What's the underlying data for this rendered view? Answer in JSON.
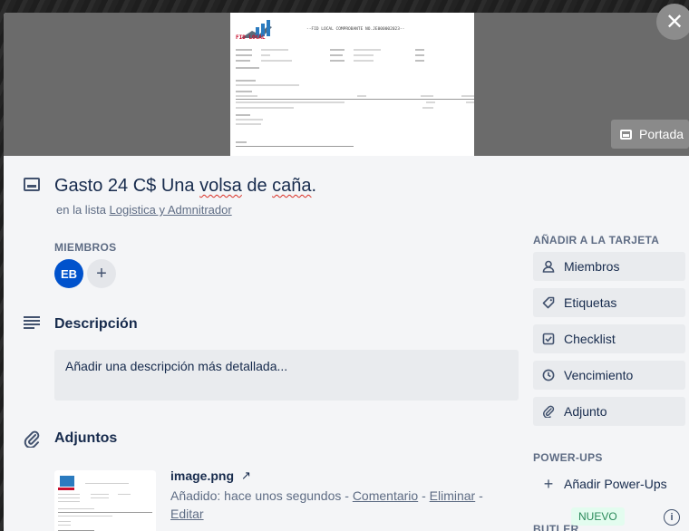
{
  "cover": {
    "doc_header": "--FID LOCAL COMPROBANTE NO.JE000002023--",
    "logo_text": "FID LOCAL",
    "button_label": "Portada"
  },
  "close_icon": "close-icon",
  "card": {
    "title_prefix": "Gasto 24 C$ Una ",
    "title_misspelled": "volsa",
    "title_middle": " de ",
    "title_misspelled2": "caña",
    "title_suffix": ".",
    "list_prefix": "en la lista ",
    "list_name": "Logistica y Admnitrador"
  },
  "members": {
    "label": "MIEMBROS",
    "avatar_initials": "EB",
    "add_symbol": "+"
  },
  "description": {
    "heading": "Descripción",
    "placeholder": "Añadir una descripción más detallada..."
  },
  "attachments": {
    "heading": "Adjuntos",
    "file_name": "image.png",
    "open_symbol": "↗",
    "added_text": "Añadido: hace unos segundos - ",
    "comment_link": "Comentario",
    "sep1": " - ",
    "delete_link": "Eliminar",
    "sep2": " - ",
    "edit_link": "Editar"
  },
  "sidebar": {
    "add_to_card_label": "AÑADIR A LA TARJETA",
    "items": [
      {
        "label": "Miembros",
        "icon": "user-icon"
      },
      {
        "label": "Etiquetas",
        "icon": "tag-icon"
      },
      {
        "label": "Checklist",
        "icon": "checkbox-icon"
      },
      {
        "label": "Vencimiento",
        "icon": "clock-icon"
      },
      {
        "label": "Adjunto",
        "icon": "paperclip-icon"
      }
    ],
    "powerups_label": "POWER-UPS",
    "add_powerups": "Añadir Power-Ups",
    "butler_label": "BUTLER",
    "new_badge": "NUEVO"
  }
}
